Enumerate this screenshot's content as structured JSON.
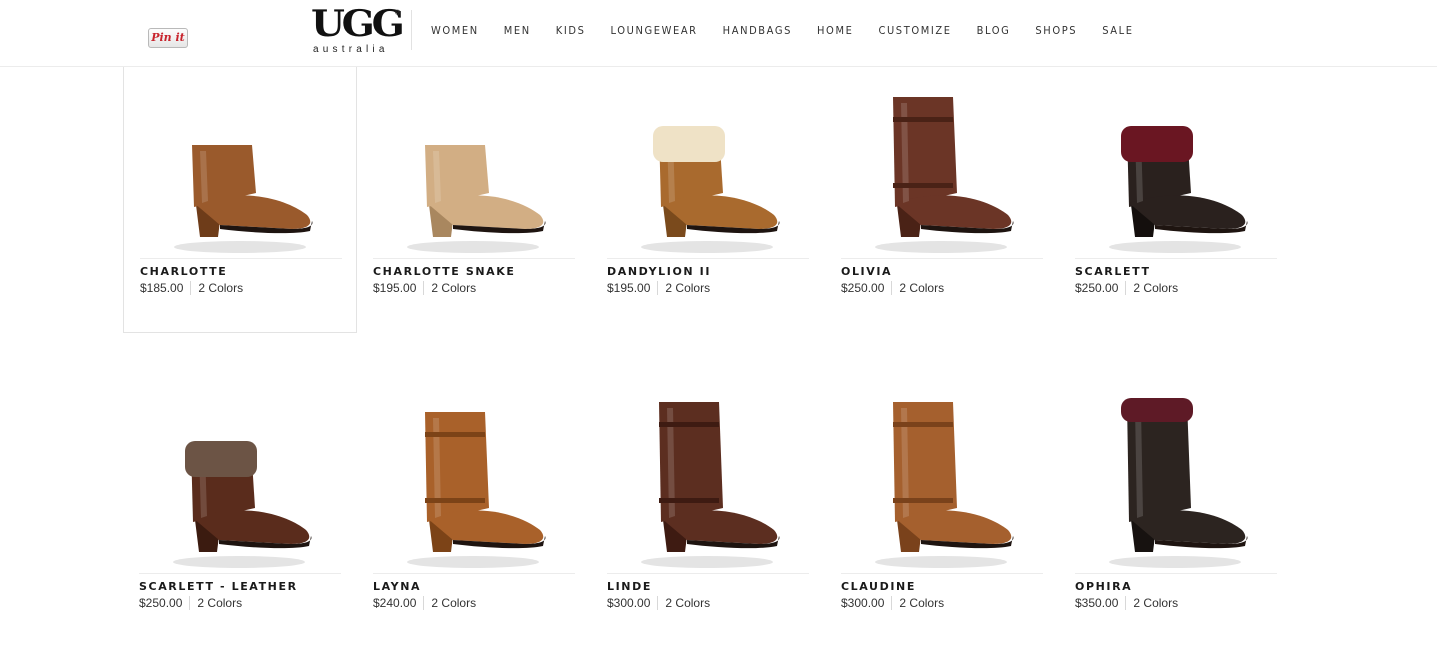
{
  "header": {
    "pinit_label": "Pin it",
    "logo": {
      "brand": "UGG",
      "sub": "australia",
      "reg": "®"
    },
    "nav": [
      "WOMEN",
      "MEN",
      "KIDS",
      "LOUNGEWEAR",
      "HANDBAGS",
      "HOME",
      "CUSTOMIZE",
      "BLOG",
      "SHOPS",
      "SALE"
    ]
  },
  "products": [
    {
      "name": "CHARLOTTE",
      "price": "$185.00",
      "colors": "2 Colors",
      "style": "ankle",
      "color": "#9a5a2c",
      "shade": "#6e3c19"
    },
    {
      "name": "CHARLOTTE SNAKE",
      "price": "$195.00",
      "colors": "2 Colors",
      "style": "ankle",
      "color": "#d2ae84",
      "shade": "#a9875f"
    },
    {
      "name": "DANDYLION II",
      "price": "$195.00",
      "colors": "2 Colors",
      "style": "cuff",
      "color": "#a96a2e",
      "shade": "#7a4a1c",
      "cuff": "#efe2c6"
    },
    {
      "name": "OLIVIA",
      "price": "$250.00",
      "colors": "2 Colors",
      "style": "mid",
      "color": "#6b3526",
      "shade": "#4a2216"
    },
    {
      "name": "SCARLETT",
      "price": "$250.00",
      "colors": "2 Colors",
      "style": "cuff",
      "color": "#2a211e",
      "shade": "#140f0d",
      "cuff": "#6a1622"
    },
    {
      "name": "SCARLETT - LEATHER",
      "price": "$250.00",
      "colors": "2 Colors",
      "style": "cuff",
      "color": "#5a2c1c",
      "shade": "#3b1b10",
      "cuff": "#6c5445"
    },
    {
      "name": "LAYNA",
      "price": "$240.00",
      "colors": "2 Colors",
      "style": "mid",
      "color": "#a9612a",
      "shade": "#7c4317"
    },
    {
      "name": "LINDE",
      "price": "$300.00",
      "colors": "2 Colors",
      "style": "tall",
      "color": "#5c2e20",
      "shade": "#3e1b12"
    },
    {
      "name": "CLAUDINE",
      "price": "$300.00",
      "colors": "2 Colors",
      "style": "tall",
      "color": "#a5602e",
      "shade": "#7a421b"
    },
    {
      "name": "OPHIRA",
      "price": "$350.00",
      "colors": "2 Colors",
      "style": "tallcuff",
      "color": "#2c2420",
      "shade": "#171210",
      "cuff": "#5e1a26"
    }
  ]
}
